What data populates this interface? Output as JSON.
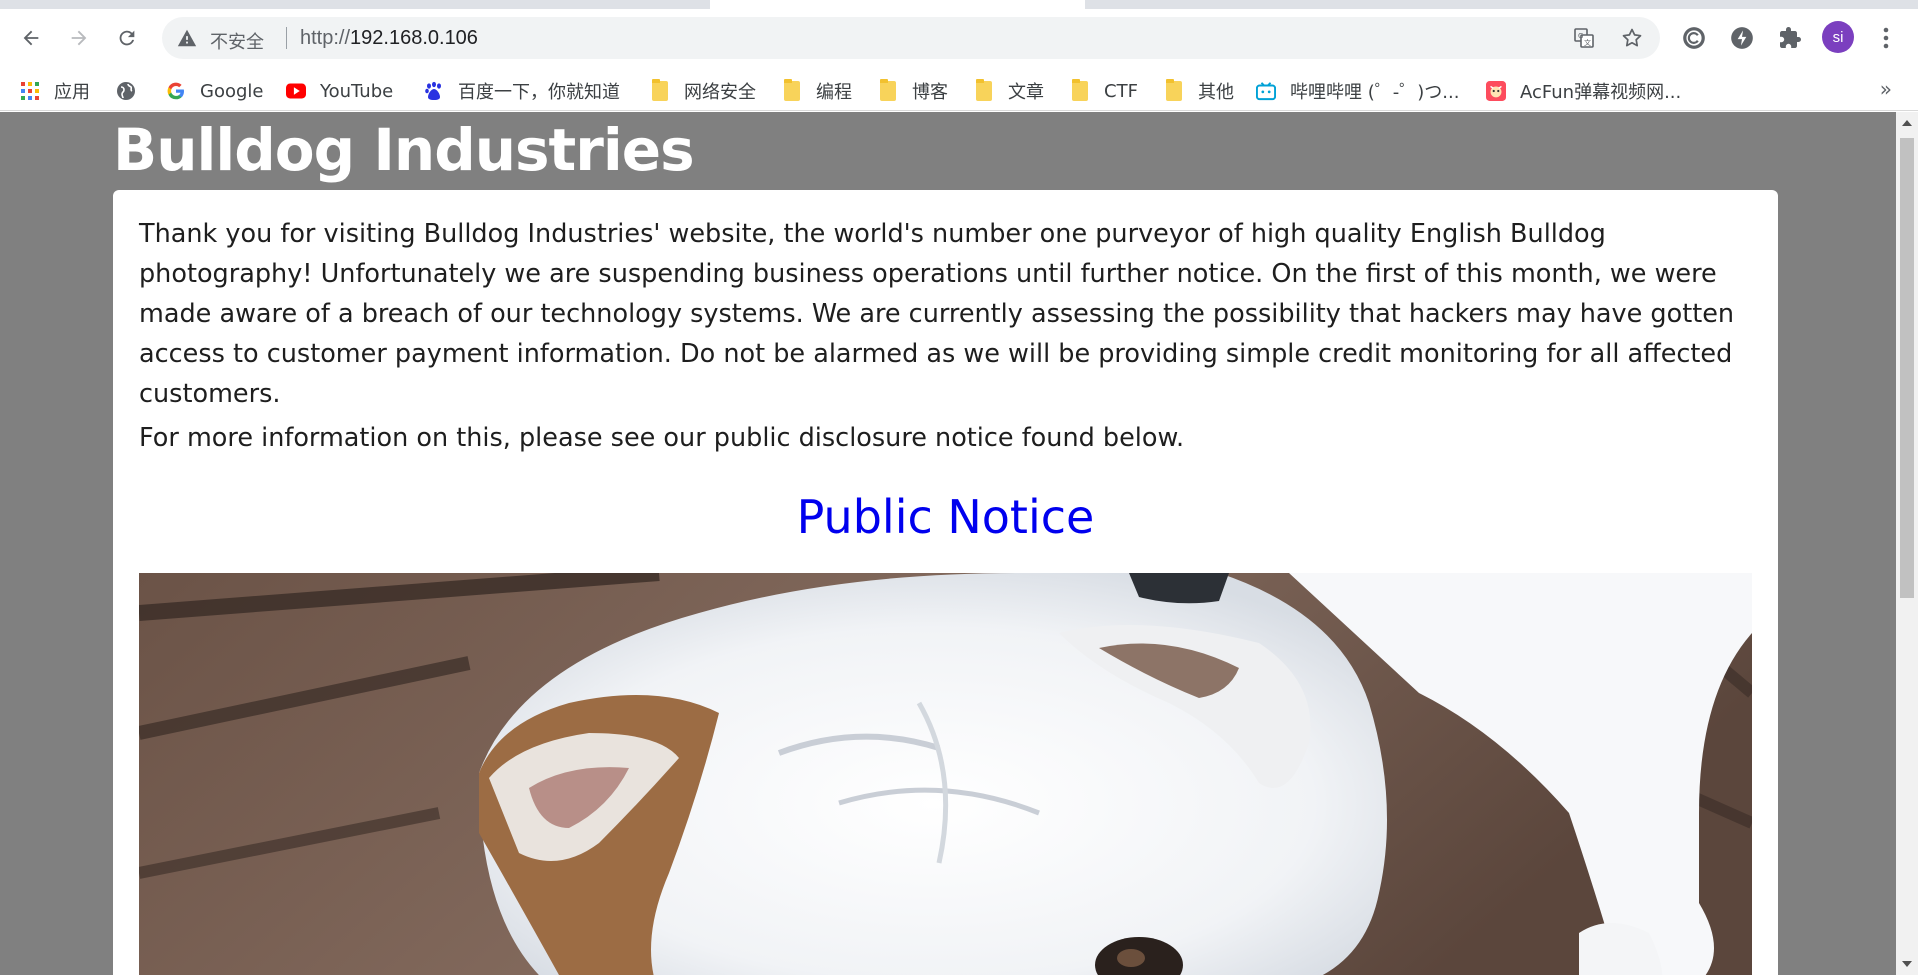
{
  "browser": {
    "security_label": "不安全",
    "url_scheme": "http://",
    "url_host": "192.168.0.106",
    "avatar_initials": "si",
    "accent_avatar": "#7b3fbf"
  },
  "bookmarks": {
    "items": [
      {
        "label": "应用",
        "icon": "apps-grid-icon"
      },
      {
        "label": "",
        "icon": "globe-icon"
      },
      {
        "label": "Google",
        "icon": "google-icon"
      },
      {
        "label": "YouTube",
        "icon": "youtube-icon"
      },
      {
        "label": "百度一下，你就知道",
        "icon": "baidu-icon"
      },
      {
        "label": "网络安全",
        "icon": "folder-icon"
      },
      {
        "label": "编程",
        "icon": "folder-icon"
      },
      {
        "label": "博客",
        "icon": "folder-icon"
      },
      {
        "label": "文章",
        "icon": "folder-icon"
      },
      {
        "label": "CTF",
        "icon": "folder-icon"
      },
      {
        "label": "其他",
        "icon": "folder-icon"
      },
      {
        "label": "哔哩哔哩 (゜-゜)つ...",
        "icon": "bilibili-icon"
      },
      {
        "label": "AcFun弹幕视频网...",
        "icon": "acfun-icon"
      }
    ],
    "more": "»"
  },
  "page": {
    "site_title": "Bulldog Industries",
    "intro": "Thank you for visiting Bulldog Industries' website, the world's number one purveyor of high quality English Bulldog photography! Unfortunately we are suspending business operations until further notice. On the first of this month, we were made aware of a breach of our technology systems. We are currently assessing the possibility that hackers may have gotten access to customer payment information. Do not be alarmed as we will be providing simple credit monitoring for all affected customers.",
    "more_info": "For more information on this, please see our public disclosure notice found below.",
    "notice_link": "Public Notice",
    "background_color": "#808080",
    "link_color": "#0000ee"
  }
}
